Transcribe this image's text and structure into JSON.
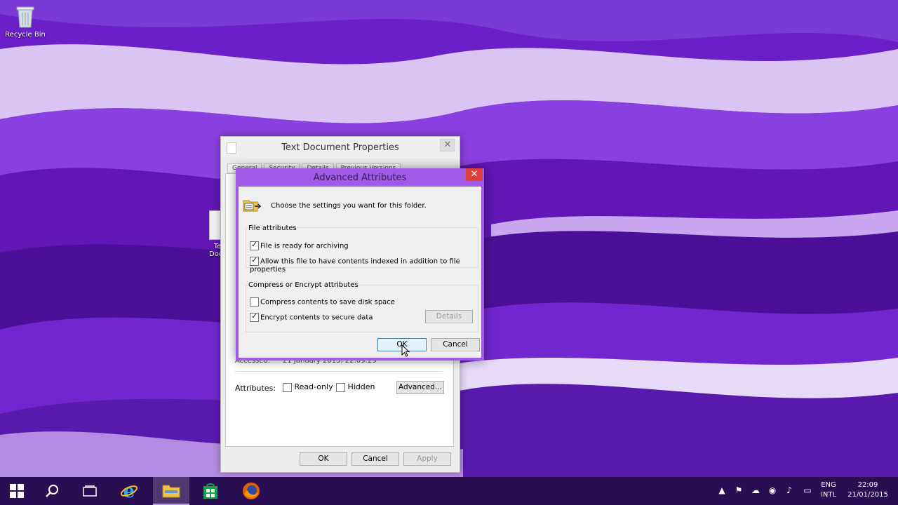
{
  "desktop": {
    "recycle_bin_label": "Recycle Bin",
    "text_doc_label_line1": "Te",
    "text_doc_label_line2": "Docu"
  },
  "properties_window": {
    "title": "Text Document Properties",
    "tabs": [
      "General",
      "Security",
      "Details",
      "Previous Versions"
    ],
    "accessed_label": "Accessed:",
    "accessed_value": "21 January 2015, 22:09:29",
    "attributes_label": "Attributes:",
    "readonly_label": "Read-only",
    "readonly_checked": false,
    "hidden_label": "Hidden",
    "hidden_checked": false,
    "advanced_button": "Advanced...",
    "ok_button": "OK",
    "cancel_button": "Cancel",
    "apply_button": "Apply"
  },
  "advanced_dialog": {
    "title": "Advanced Attributes",
    "intro": "Choose the settings you want for this folder.",
    "file_attributes_label": "File attributes",
    "archive_label": "File is ready for archiving",
    "archive_checked": true,
    "index_label": "Allow this file to have contents indexed in addition to file properties",
    "index_checked": true,
    "compress_encrypt_label": "Compress or Encrypt attributes",
    "compress_label": "Compress contents to save disk space",
    "compress_checked": false,
    "encrypt_label": "Encrypt contents to secure data",
    "encrypt_checked": true,
    "details_button": "Details",
    "ok_button": "OK",
    "cancel_button": "Cancel"
  },
  "taskbar": {
    "language_line1": "ENG",
    "language_line2": "INTL",
    "time": "22:09",
    "date": "21/01/2015"
  },
  "colors": {
    "wallpaper_purple": "#6a1fc8",
    "dialog_title_purple": "#a15ae8",
    "close_red": "#e0403a",
    "taskbar": "#2a0e52"
  }
}
